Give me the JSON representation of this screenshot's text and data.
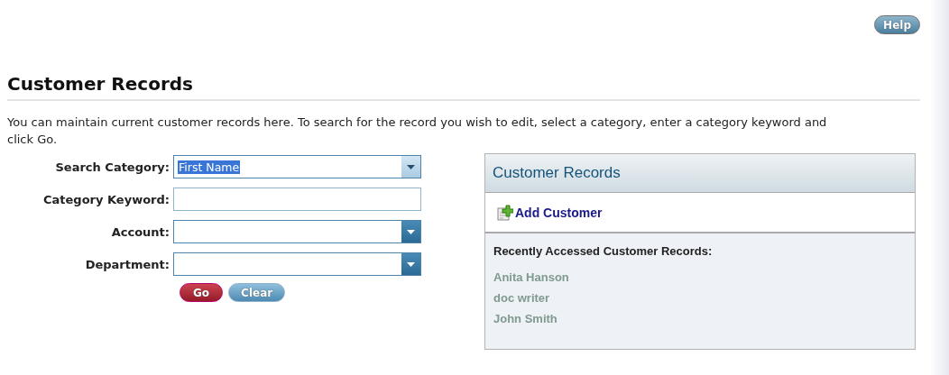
{
  "help_button": "Help",
  "page_title": "Customer Records",
  "description": "You can maintain current customer records here. To search for the record you wish to edit, select a category, enter a category keyword and click Go.",
  "search_form": {
    "fields": [
      {
        "label": "Search Category:",
        "kind": "select",
        "value": "First Name"
      },
      {
        "label": "Category Keyword:",
        "kind": "text"
      },
      {
        "label": "Account:",
        "kind": "select"
      },
      {
        "label": "Department:",
        "kind": "select"
      }
    ],
    "buttons": [
      {
        "label": "Go",
        "kind": "primary"
      },
      {
        "label": "Clear",
        "kind": "secondary"
      }
    ]
  },
  "records_panel": {
    "title": "Customer Records",
    "add_link": "Add Customer",
    "recent_heading": "Recently Accessed Customer Records:",
    "recent": [
      "Anita Hanson",
      "doc writer",
      "John Smith"
    ]
  }
}
